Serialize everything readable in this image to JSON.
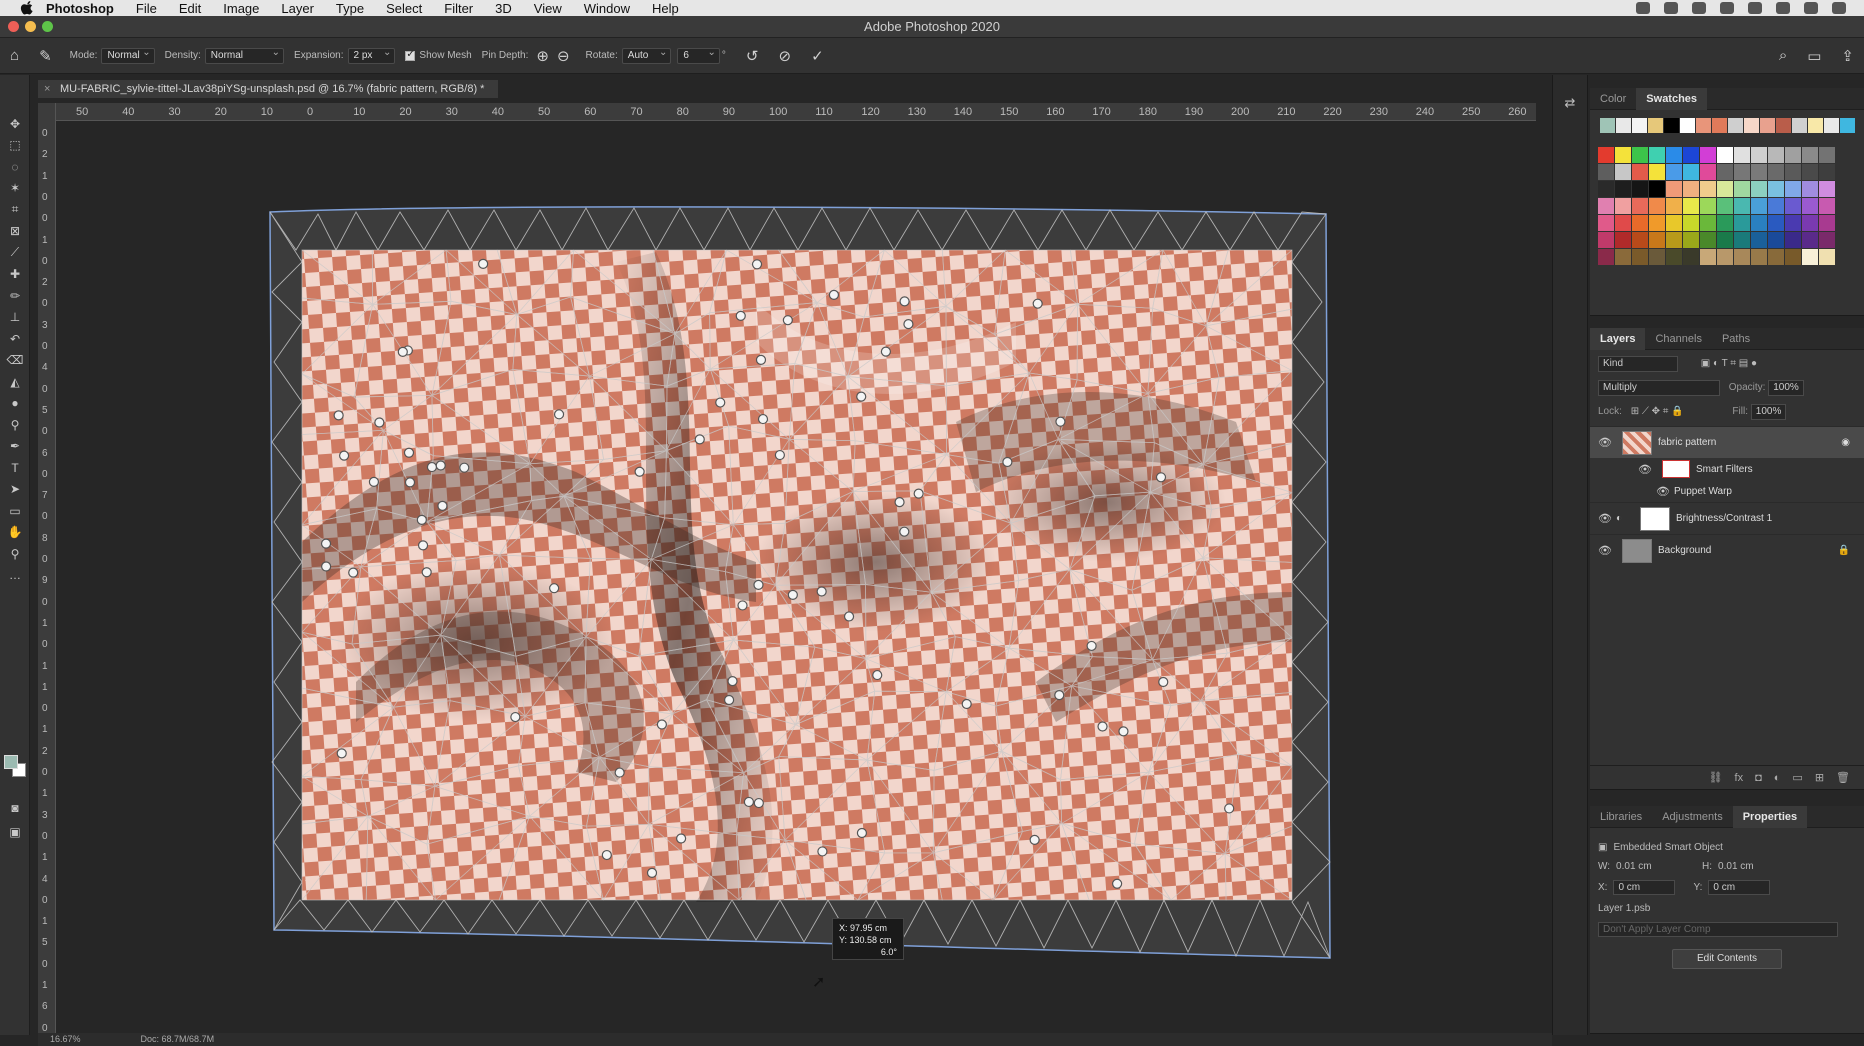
{
  "menubar": {
    "app": "Photoshop",
    "items": [
      "File",
      "Edit",
      "Image",
      "Layer",
      "Type",
      "Select",
      "Filter",
      "3D",
      "View",
      "Window",
      "Help"
    ]
  },
  "window": {
    "title": "Adobe Photoshop 2020"
  },
  "options": {
    "mode_label": "Mode:",
    "mode_value": "Normal",
    "density_label": "Density:",
    "density_value": "Normal",
    "expansion_label": "Expansion:",
    "expansion_value": "2 px",
    "show_mesh": "Show Mesh",
    "pin_depth_label": "Pin Depth:",
    "rotate_label": "Rotate:",
    "rotate_value": "Auto",
    "rotate_angle": "6",
    "rotate_degree": "°"
  },
  "document": {
    "tab_title": "MU-FABRIC_sylvie-tittel-JLav38piYSg-unsplash.psd @ 16.7% (fabric pattern, RGB/8) *"
  },
  "ruler_h": [
    "50",
    "40",
    "30",
    "20",
    "10",
    "0",
    "10",
    "20",
    "30",
    "40",
    "50",
    "60",
    "70",
    "80",
    "90",
    "100",
    "110",
    "120",
    "130",
    "140",
    "150",
    "160",
    "170",
    "180",
    "190",
    "200",
    "210",
    "220",
    "230",
    "240",
    "250",
    "260"
  ],
  "ruler_v": [
    "0",
    "2",
    "1",
    "0",
    "0",
    "1",
    "0",
    "2",
    "0",
    "3",
    "0",
    "4",
    "0",
    "5",
    "0",
    "6",
    "0",
    "7",
    "0",
    "8",
    "0",
    "9",
    "0",
    "1",
    "0",
    "1",
    "1",
    "0",
    "1",
    "2",
    "0",
    "1",
    "3",
    "0",
    "1",
    "4",
    "0",
    "1",
    "5",
    "0",
    "1",
    "6",
    "0"
  ],
  "tooltip": {
    "x": "X: 97.95 cm",
    "y": "Y: 130.58 cm",
    "angle": "6.0°"
  },
  "swatches_panel": {
    "tabs": [
      "Color",
      "Swatches"
    ],
    "recent": [
      "#9fc4b6",
      "#e8e8e8",
      "#f4f4f4",
      "#e6c87a",
      "#000000",
      "#ffffff",
      "#e8957a",
      "#e07a5a",
      "#cfcfcf",
      "#f6d7c8",
      "#e8a18e",
      "#b95d4a",
      "#d0d0d0",
      "#f8e8a8",
      "#e8e8e8",
      "#3fb7e0"
    ],
    "rows": [
      [
        "#e33b2e",
        "#f4e23a",
        "#3cc44a",
        "#3fd0b0",
        "#2a8be8",
        "#1c46d6",
        "#d23ed6",
        "#ffffff",
        "#e0e0e0",
        "#cfcfcf",
        "#b8b8b8",
        "#a0a0a0",
        "#8a8a8a",
        "#737373"
      ],
      [
        "#5e5e5e",
        "#c7c7c7",
        "#e35b4a",
        "#f4e23a",
        "#4a9be8",
        "#3fb7e0",
        "#e04a9a",
        "#666666",
        "#777777",
        "#7a7a7a",
        "#6a6a6a",
        "#5a5a5a",
        "#4a4a4a",
        "#3e3e3e"
      ],
      [
        "#2a2a2a",
        "#1e1e1e",
        "#151515",
        "#000000",
        "#f09a78",
        "#f0b080",
        "#f0cc8c",
        "#d8e89a",
        "#a0d8a0",
        "#8cd0c0",
        "#7ac0e0",
        "#80a8e8",
        "#a08ce0",
        "#d08ce0"
      ],
      [
        "#e080b0",
        "#f0a0a0",
        "#e86a5a",
        "#f08a4a",
        "#f0b04a",
        "#e8e84a",
        "#9cd85a",
        "#5ac07a",
        "#4ab8b0",
        "#4aa0d8",
        "#4a7ad8",
        "#6a5ad0",
        "#9a5ad0",
        "#c85ab0"
      ],
      [
        "#e05a8a",
        "#e04a4a",
        "#e86a2a",
        "#f09a2a",
        "#e8c82a",
        "#c8d82a",
        "#6ab83a",
        "#2a9a5a",
        "#2a9a9a",
        "#2a80c0",
        "#2a5ac0",
        "#4a3ab0",
        "#7a3ab0",
        "#a83a90"
      ],
      [
        "#c03a6a",
        "#b02a2a",
        "#b84a1a",
        "#c8781a",
        "#b89a1a",
        "#9aa81a",
        "#4a882a",
        "#1a7a4a",
        "#1a7a7a",
        "#1a609a",
        "#1a4a9a",
        "#3a2a8a",
        "#5a2a8a",
        "#7a2a6a"
      ],
      [
        "#8a2a4a",
        "#8a6a3a",
        "#7a5a2a",
        "#6a5a3a",
        "#4a4a2a",
        "#3a3a2a",
        "#c8a878",
        "#b8986a",
        "#a8885a",
        "#987a4a",
        "#886a3a",
        "#785a2a",
        "#f8f0d8",
        "#f0e0b0"
      ]
    ]
  },
  "layers_panel": {
    "tabs": [
      "Layers",
      "Channels",
      "Paths"
    ],
    "kind_placeholder": "Kind",
    "blend_mode": "Multiply",
    "opacity_label": "Opacity:",
    "opacity_value": "100%",
    "lock_label": "Lock:",
    "fill_label": "Fill:",
    "fill_value": "100%",
    "layers": [
      {
        "name": "fabric pattern"
      },
      {
        "name": "Smart Filters"
      },
      {
        "name": "Puppet Warp"
      },
      {
        "name": "Brightness/Contrast 1"
      },
      {
        "name": "Background"
      }
    ]
  },
  "properties_panel": {
    "tabs": [
      "Libraries",
      "Adjustments",
      "Properties"
    ],
    "type": "Embedded Smart Object",
    "w_label": "W:",
    "w_value": "0.01 cm",
    "h_label": "H:",
    "h_value": "0.01 cm",
    "x_label": "X:",
    "x_value": "0 cm",
    "y_label": "Y:",
    "y_value": "0 cm",
    "file": "Layer 1.psb",
    "comp_placeholder": "Don't Apply Layer Comp",
    "edit_button": "Edit Contents"
  },
  "status": {
    "zoom": "16.67%",
    "doc": "Doc: 68.7M/68.7M"
  },
  "colors": {
    "accent": "#6a8fd8",
    "fabric": "#d98e78",
    "mesh": "#c8c8c8"
  }
}
